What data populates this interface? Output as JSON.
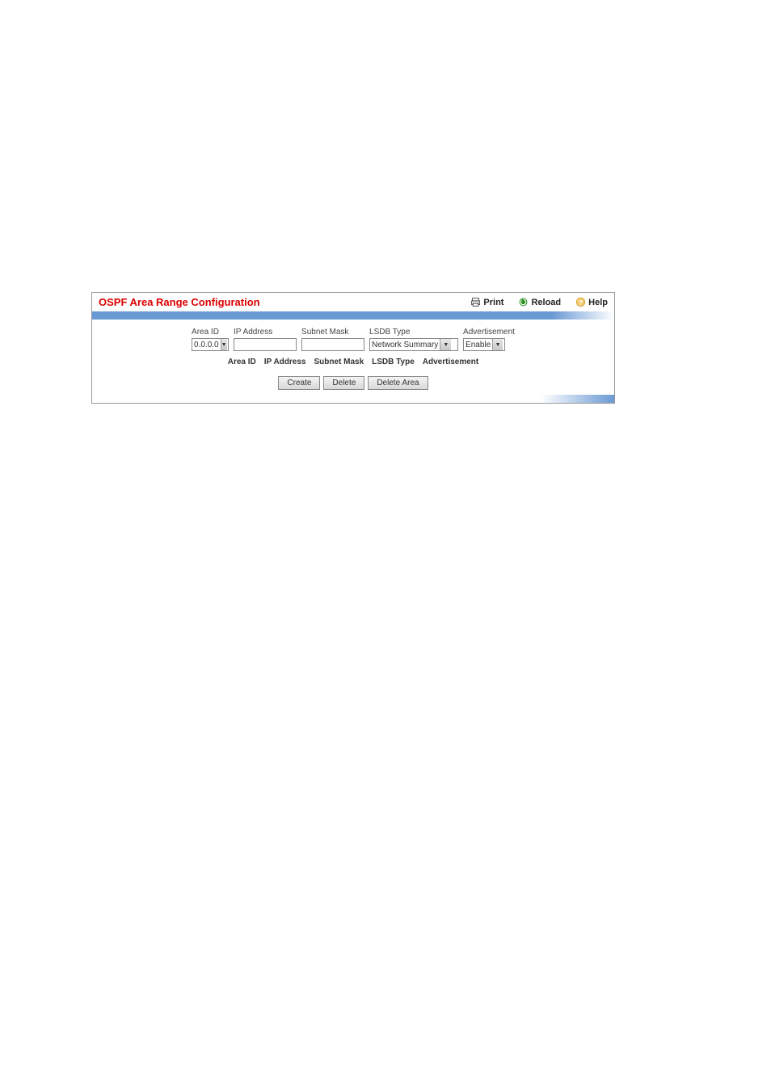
{
  "header": {
    "title": "OSPF Area Range Configuration",
    "print": "Print",
    "reload": "Reload",
    "help": "Help"
  },
  "form": {
    "area_id": {
      "label": "Area ID",
      "value": "0.0.0.0"
    },
    "ip_address": {
      "label": "IP Address",
      "value": ""
    },
    "subnet_mask": {
      "label": "Subnet Mask",
      "value": ""
    },
    "lsdb_type": {
      "label": "LSDB Type",
      "value": "Network Summary"
    },
    "advertisement": {
      "label": "Advertisement",
      "value": "Enable"
    }
  },
  "table_headers": {
    "area_id": "Area ID",
    "ip_address": "IP Address",
    "subnet_mask": "Subnet Mask",
    "lsdb_type": "LSDB Type",
    "advertisement": "Advertisement"
  },
  "buttons": {
    "create": "Create",
    "delete": "Delete",
    "delete_area": "Delete Area"
  }
}
